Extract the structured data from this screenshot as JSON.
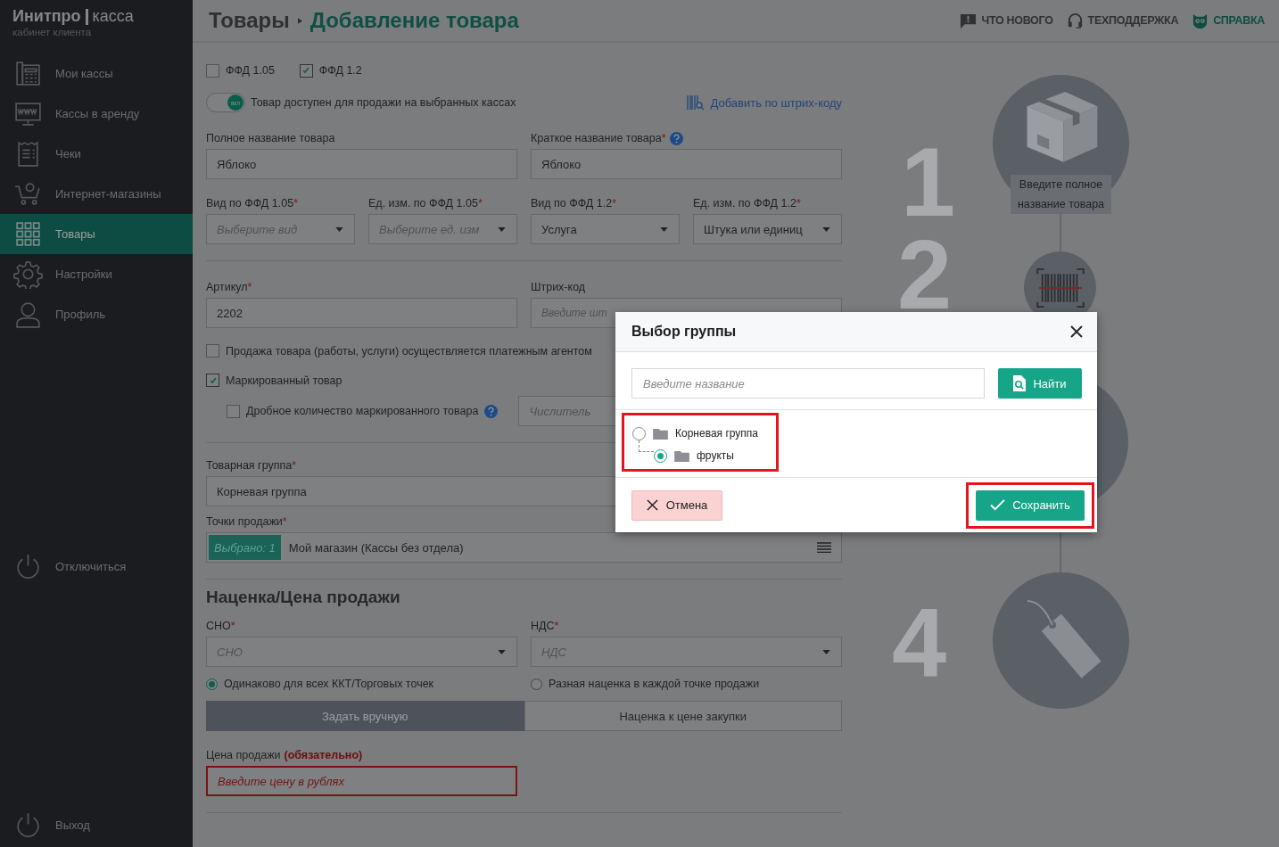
{
  "brand": {
    "name": "Инитпро",
    "product": "касса",
    "subtitle": "кабинет клиента"
  },
  "sidebar": {
    "items": [
      {
        "label": "Мои кассы",
        "selected": false
      },
      {
        "label": "Кассы в аренду",
        "selected": false
      },
      {
        "label": "Чеки",
        "selected": false
      },
      {
        "label": "Интернет-магазины",
        "selected": false
      },
      {
        "label": "Товары",
        "selected": true
      },
      {
        "label": "Настройки",
        "selected": false
      },
      {
        "label": "Профиль",
        "selected": false
      }
    ],
    "footer": [
      {
        "label": "Отключиться"
      },
      {
        "label": "Выход"
      }
    ]
  },
  "header": {
    "breadcrumb": [
      "Товары",
      "Добавление товара"
    ],
    "links": [
      {
        "label": "ЧТО НОВОГО",
        "highlighted": false
      },
      {
        "label": "ТЕХПОДДЕРЖКА",
        "highlighted": false
      },
      {
        "label": "СПРАВКА",
        "highlighted": true
      }
    ]
  },
  "form": {
    "ffd": [
      {
        "label": "ФФД 1.05",
        "checked": false
      },
      {
        "label": "ФФД 1.2",
        "checked": true
      }
    ],
    "toggle": {
      "on": true,
      "badge": "вкл",
      "label": "Товар доступен для продажи на выбранных кассах"
    },
    "barcode_link": "Добавить по штрих-коду",
    "names": [
      {
        "label": "Полное название товара",
        "value": "Яблоко"
      },
      {
        "label": "Краткое название товара",
        "required_mark": "*",
        "help": true,
        "value": "Яблоко"
      }
    ],
    "units": [
      {
        "label": "Вид по ФФД 1.05",
        "required_mark": "*",
        "placeholder": "Выберите вид"
      },
      {
        "label": "Ед. изм. по ФФД 1.05",
        "required_mark": "*",
        "placeholder": "Выберите ед. изм"
      },
      {
        "label": "Вид по ФФД 1.2",
        "required_mark": "*",
        "value": "Услуга"
      },
      {
        "label": "Ед. изм. по ФФД 1.2",
        "required_mark": "*",
        "value": "Штука или единиц"
      }
    ],
    "codes": [
      {
        "label": "Артикул",
        "required_mark": "*",
        "value": "2202"
      },
      {
        "label": "Штрих-код",
        "placeholder": "Введите шт"
      }
    ],
    "checks": [
      {
        "label": "Продажа товара (работы, услуги) осуществляется платежным агентом",
        "checked": false
      },
      {
        "label": "Маркированный товар",
        "checked": true
      }
    ],
    "fraction": {
      "label": "Дробное количество маркированного товара",
      "checked": false,
      "help": true,
      "placeholder": "Числитель"
    },
    "group": {
      "label": "Товарная группа",
      "required_mark": "*",
      "value": "Корневая группа"
    },
    "points": {
      "label": "Точки продажи",
      "required_mark": "*",
      "badge": "Выбрано: 1",
      "value": "Мой магазин (Кассы без отдела)"
    },
    "markup": {
      "title": "Наценка/Цена продажи",
      "selects": [
        {
          "label": "СНО",
          "required_mark": "*",
          "placeholder": "СНО"
        },
        {
          "label": "НДС",
          "required_mark": "*",
          "placeholder": "НДС"
        }
      ],
      "radios": [
        {
          "label": "Одинаково для всех ККТ/Торговых точек",
          "selected": true
        },
        {
          "label": "Разная наценка в каждой точке продажи",
          "selected": false
        }
      ],
      "segments": [
        {
          "label": "Задать вручную",
          "selected": true
        },
        {
          "label": "Наценка к цене закупки",
          "selected": false
        }
      ],
      "price": {
        "label": "Цена продажи",
        "note": "(обязательно)",
        "placeholder": "Введите цену в рублях",
        "error": true
      }
    }
  },
  "steps": [
    {
      "number": "1",
      "caption": "Введите полное название товара"
    },
    {
      "number": "2"
    },
    {
      "number": "4"
    }
  ],
  "modal": {
    "title": "Выбор группы",
    "search_placeholder": "Введите название",
    "find": "Найти",
    "tree": {
      "highlighted": true,
      "items": [
        {
          "label": "Корневая группа",
          "selected": false,
          "children": [
            {
              "label": "фрукты",
              "selected": true
            }
          ]
        }
      ]
    },
    "cancel": "Отмена",
    "save": {
      "label": "Сохранить",
      "highlighted": true
    }
  }
}
